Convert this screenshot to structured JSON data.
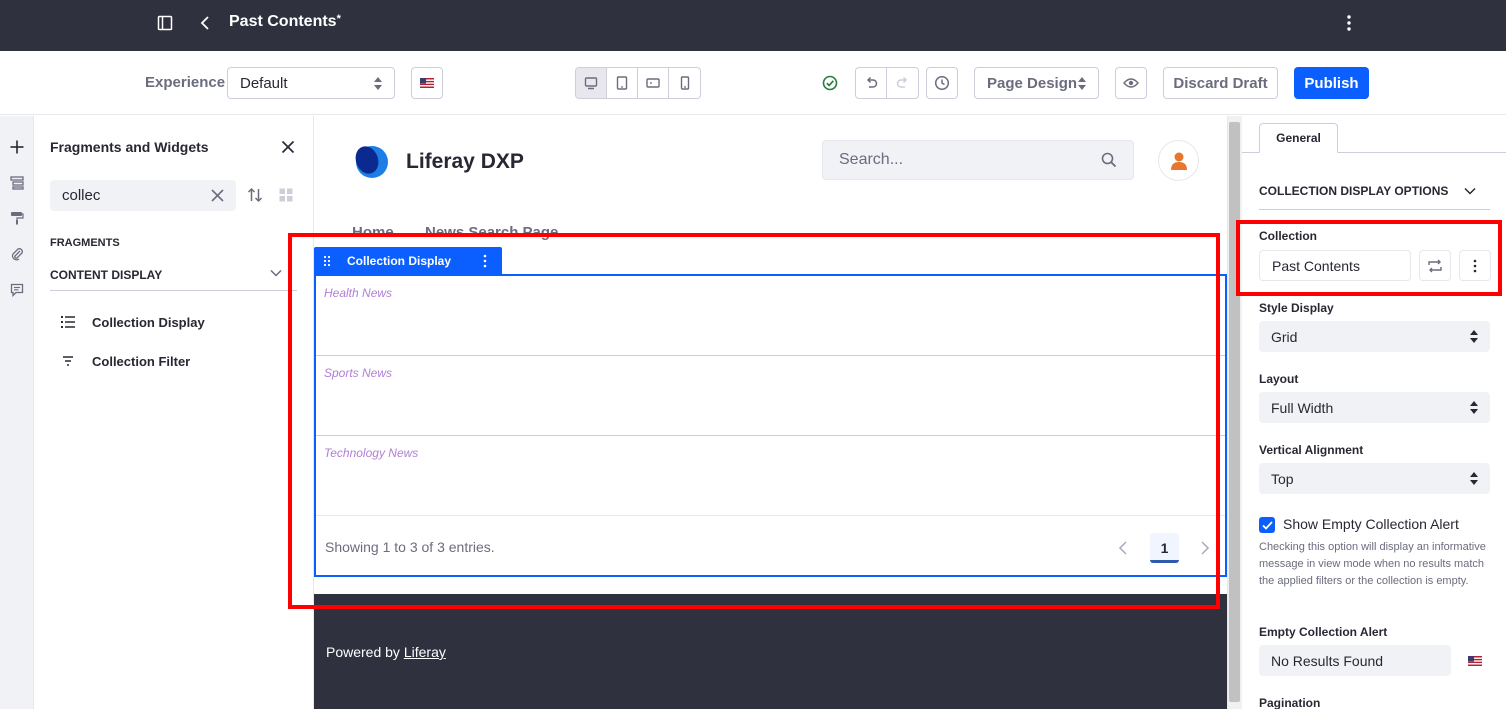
{
  "topbar": {
    "title": "Past Contents",
    "modified_marker": "*"
  },
  "toolbar": {
    "experience_label": "Experience",
    "experience_value": "Default",
    "page_design_label": "Page Design",
    "discard_label": "Discard Draft",
    "publish_label": "Publish"
  },
  "fragments_panel": {
    "title": "Fragments and Widgets",
    "search_value": "collec",
    "section_label": "FRAGMENTS",
    "category_label": "CONTENT DISPLAY",
    "items": [
      {
        "label": "Collection Display",
        "icon": "list-icon"
      },
      {
        "label": "Collection Filter",
        "icon": "filter-icon"
      }
    ]
  },
  "site": {
    "brand_name": "Liferay DXP",
    "search_placeholder": "Search...",
    "nav": [
      "Home",
      "News Search Page"
    ],
    "footer_prefix": "Powered by ",
    "footer_link": "Liferay"
  },
  "collection_display": {
    "tag_label": "Collection Display",
    "rows": [
      "Health News",
      "Sports News",
      "Technology News"
    ],
    "entries_text": "Showing 1 to 3 of 3 entries.",
    "current_page": "1"
  },
  "config_panel": {
    "tab_label": "General",
    "section_title": "COLLECTION DISPLAY OPTIONS",
    "collection_label": "Collection",
    "collection_value": "Past Contents",
    "style_display_label": "Style Display",
    "style_display_value": "Grid",
    "layout_label": "Layout",
    "layout_value": "Full Width",
    "vertical_alignment_label": "Vertical Alignment",
    "vertical_alignment_value": "Top",
    "show_empty_alert_label": "Show Empty Collection Alert",
    "show_empty_alert_checked": true,
    "show_empty_alert_help": "Checking this option will display an informative message in view mode when no results match the applied filters or the collection is empty.",
    "empty_alert_label": "Empty Collection Alert",
    "empty_alert_value": "No Results Found",
    "pagination_label": "Pagination"
  },
  "colors": {
    "primary": "#0b5fff",
    "dark_bar": "#30313f",
    "highlight": "#ff0000",
    "success": "#287d3c"
  }
}
